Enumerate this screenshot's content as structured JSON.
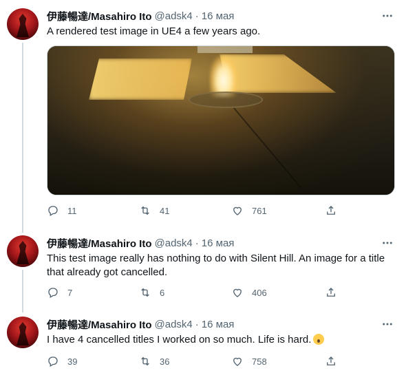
{
  "tweets": [
    {
      "name": "伊藤暢達/Masahiro Ito",
      "handle": "@adsk4",
      "separator": "·",
      "date": "16 мая",
      "text": "A rendered test image in UE4 a few years ago.",
      "replies": "11",
      "retweets": "41",
      "likes": "761"
    },
    {
      "name": "伊藤暢達/Masahiro Ito",
      "handle": "@adsk4",
      "separator": "·",
      "date": "16 мая",
      "text_line1": "This test image really has nothing to do with Silent Hill. An image for a title",
      "text_line2": "that already got cancelled.",
      "replies": "7",
      "retweets": "6",
      "likes": "406"
    },
    {
      "name": "伊藤暢達/Masahiro Ito",
      "handle": "@adsk4",
      "separator": "·",
      "date": "16 мая",
      "text": "I have 4 cancelled titles I worked on so much. Life is hard.",
      "emoji": "anxious-face-with-sweat-emoji",
      "replies": "39",
      "retweets": "36",
      "likes": "758"
    }
  ],
  "icons": {
    "reply": "reply-icon",
    "retweet": "retweet-icon",
    "like": "like-icon",
    "share": "share-icon",
    "more": "more-icon"
  },
  "colors": {
    "text": "#0f1419",
    "secondary": "#536471",
    "thread_line": "#cfd9de",
    "background": "#ffffff"
  }
}
